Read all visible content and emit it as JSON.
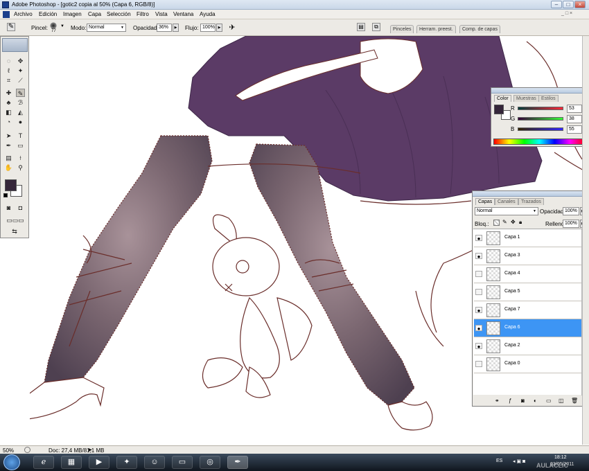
{
  "window": {
    "title": "Adobe Photoshop - [gotic2 copia al 50% (Capa 6, RGB/8)]",
    "controls": [
      "minimize",
      "maximize",
      "close"
    ]
  },
  "menu": [
    "Archivo",
    "Edición",
    "Imagen",
    "Capa",
    "Selección",
    "Filtro",
    "Vista",
    "Ventana",
    "Ayuda"
  ],
  "options": {
    "brush_label": "Pincel:",
    "brush_size": "77",
    "mode_label": "Modo:",
    "mode_value": "Normal",
    "opacity_label": "Opacidad:",
    "opacity_value": "36%",
    "flow_label": "Flujo:",
    "flow_value": "100%"
  },
  "workspace_tabs": [
    "Pinceles",
    "Herram. preest.",
    "Comp. de capas"
  ],
  "color_panel": {
    "tabs": [
      "Color",
      "Muestras",
      "Estilos"
    ],
    "r_label": "R",
    "r_value": "53",
    "g_label": "G",
    "g_value": "38",
    "b_label": "B",
    "b_value": "55",
    "foreground": "#35263a",
    "background": "#ffffff"
  },
  "layers_panel": {
    "tabs": [
      "Capas",
      "Canales",
      "Trazados"
    ],
    "blend_mode": "Normal",
    "opacity_label": "Opacidad:",
    "opacity_value": "100%",
    "lock_label": "Bloq.:",
    "fill_label": "Relleno:",
    "fill_value": "100%",
    "layers": [
      {
        "name": "Capa 1",
        "visible": true,
        "selected": false
      },
      {
        "name": "Capa 3",
        "visible": true,
        "selected": false
      },
      {
        "name": "Capa 4",
        "visible": false,
        "selected": false
      },
      {
        "name": "Capa 5",
        "visible": false,
        "selected": false
      },
      {
        "name": "Capa 7",
        "visible": true,
        "selected": false
      },
      {
        "name": "Capa 6",
        "visible": true,
        "selected": true
      },
      {
        "name": "Capa 2",
        "visible": true,
        "selected": false
      },
      {
        "name": "Capa 0",
        "visible": false,
        "selected": false
      }
    ]
  },
  "toolbox": {
    "foreground": "#35263a",
    "background": "#ffffff"
  },
  "status": {
    "zoom": "50%",
    "doc": "Doc: 27,4 MB/81,1 MB"
  },
  "taskbar": {
    "lang": "ES",
    "time": "18:12",
    "date": "03/05/2011",
    "watermark": "AULACLIC"
  },
  "colors": {
    "dress": "#5b3b66",
    "stocking": "#8f7a82",
    "lineart": "#6a2d2a",
    "selection": "#3d95f4"
  }
}
